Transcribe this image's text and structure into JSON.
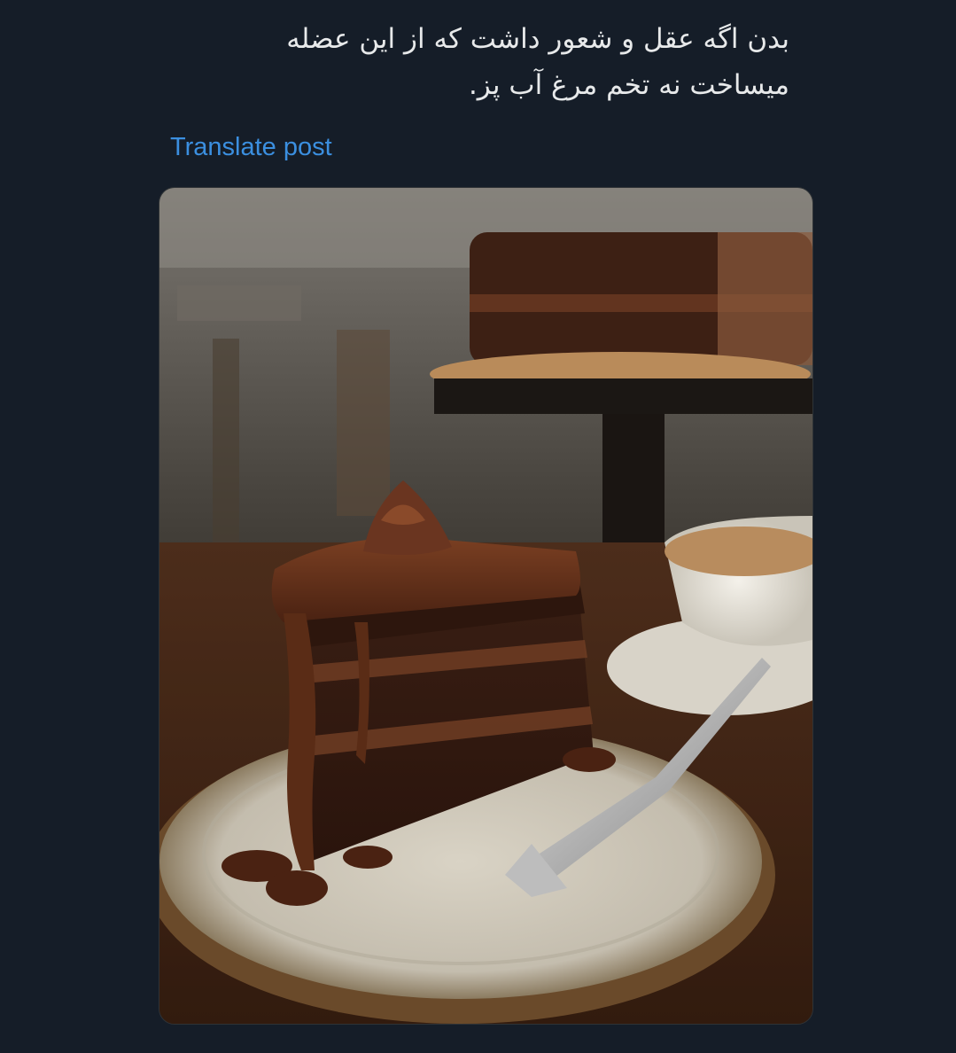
{
  "post": {
    "text_lines": [
      "بدن اگه عقل و شعور داشت که از این عضله",
      "میساخت نه تخم مرغ آب پز."
    ],
    "translate_label": "Translate post"
  },
  "media": {
    "alt": "chocolate-cake-photo"
  },
  "colors": {
    "background": "#151d28",
    "text": "#e7e9ea",
    "link": "#3b8fe0"
  }
}
